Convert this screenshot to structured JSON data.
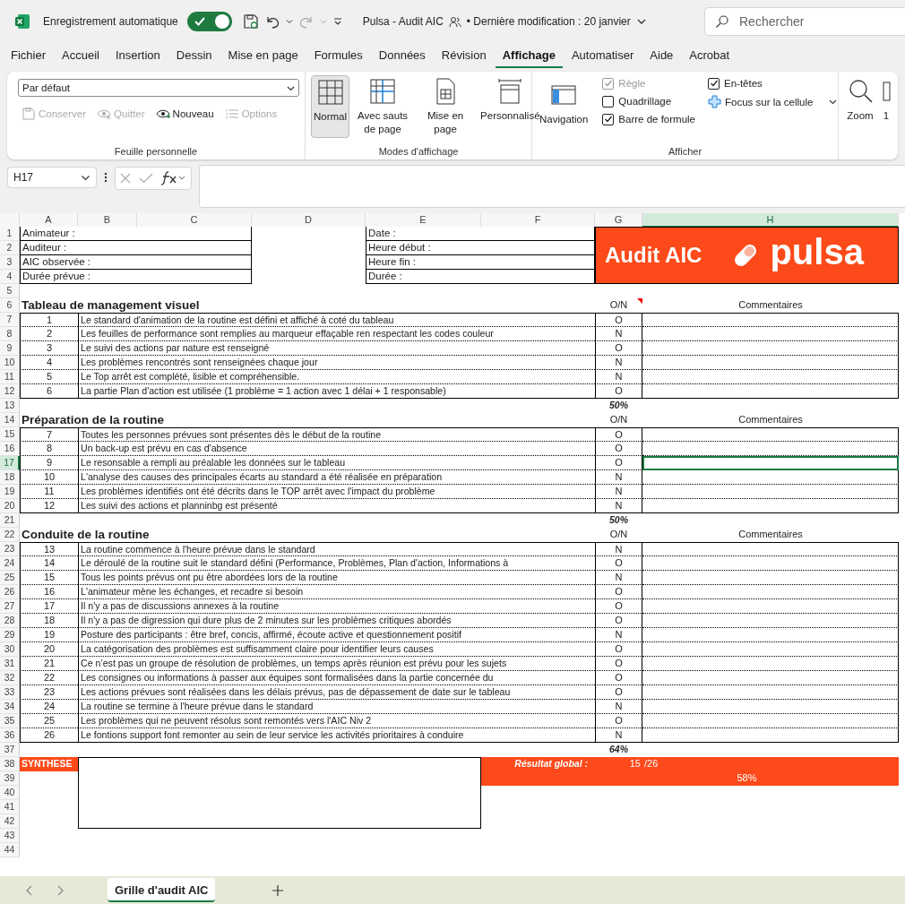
{
  "titlebar": {
    "autosave_label": "Enregistrement automatique",
    "autosave_on": true,
    "title": "Pulsa - Audit AIC",
    "modified": "• Dernière modification : 20 janvier",
    "search_placeholder": "Rechercher"
  },
  "menu_tabs": [
    {
      "label": "Fichier",
      "selected": false
    },
    {
      "label": "Accueil",
      "selected": false
    },
    {
      "label": "Insertion",
      "selected": false
    },
    {
      "label": "Dessin",
      "selected": false
    },
    {
      "label": "Mise en page",
      "selected": false
    },
    {
      "label": "Formules",
      "selected": false
    },
    {
      "label": "Données",
      "selected": false
    },
    {
      "label": "Révision",
      "selected": false
    },
    {
      "label": "Affichage",
      "selected": true
    },
    {
      "label": "Automatiser",
      "selected": false
    },
    {
      "label": "Aide",
      "selected": false
    },
    {
      "label": "Acrobat",
      "selected": false
    }
  ],
  "ribbon": {
    "sheet_view": {
      "dropdown": "Par défaut",
      "group_label": "Feuille personnelle",
      "buttons": [
        {
          "label": "Conserver",
          "disabled": true
        },
        {
          "label": "Quitter",
          "disabled": true
        },
        {
          "label": "Nouveau",
          "disabled": false
        },
        {
          "label": "Options",
          "disabled": true
        }
      ]
    },
    "views": {
      "group_label": "Modes d'affichage",
      "buttons": [
        {
          "label": "Normal",
          "selected": true
        },
        {
          "label": "Avec sauts de page",
          "selected": false
        },
        {
          "label": "Mise en page",
          "selected": false
        },
        {
          "label": "Personnalisé",
          "selected": false
        }
      ]
    },
    "show": {
      "navigation": "Navigation",
      "focus": "Focus sur la cellule",
      "group_label": "Afficher",
      "checkboxes": [
        {
          "label": "Règle",
          "checked": true,
          "disabled": true
        },
        {
          "label": "Quadrillage",
          "checked": false,
          "disabled": false
        },
        {
          "label": "Barre de formule",
          "checked": true,
          "disabled": false
        },
        {
          "label": "En-têtes",
          "checked": true,
          "disabled": false
        }
      ]
    },
    "zoom": {
      "label": "Zoom",
      "cut_label": "1"
    }
  },
  "formula_bar": {
    "name_box": "H17"
  },
  "sheet": {
    "column_headers": [
      {
        "label": "A",
        "selected": false
      },
      {
        "label": "B",
        "selected": false
      },
      {
        "label": "C",
        "selected": false
      },
      {
        "label": "D",
        "selected": false
      },
      {
        "label": "E",
        "selected": false
      },
      {
        "label": "F",
        "selected": false
      },
      {
        "label": "G",
        "selected": false
      },
      {
        "label": "H",
        "selected": true
      }
    ],
    "row_numbers": [
      "1",
      "2",
      "3",
      "4",
      "5",
      "6",
      "7",
      "8",
      "9",
      "10",
      "11",
      "12",
      "13",
      "14",
      "15",
      "16",
      "17",
      "18",
      "19",
      "20",
      "21",
      "22",
      "23",
      "24",
      "25",
      "26",
      "27",
      "28",
      "29",
      "30",
      "31",
      "32",
      "33",
      "34",
      "35",
      "36",
      "37",
      "38",
      "39",
      "40",
      "41",
      "42",
      "43",
      "44"
    ],
    "info_left": [
      "Animateur :",
      "Auditeur :",
      "AIC observée :",
      "Durée prévue :"
    ],
    "info_right": [
      "Date :",
      "Heure début :",
      "Heure fin :",
      "Durée :"
    ],
    "logo": {
      "title": "Audit AIC",
      "brand": "pulsa"
    },
    "sections": [
      {
        "title": "Tableau de management visuel",
        "answer_header": "O/N",
        "comment_header": "Commentaires",
        "comment_marker": true,
        "score": "50%",
        "items": [
          {
            "number": "1",
            "text": "Le standard d'animation de la routine est défini et affiché à coté du tableau",
            "answer": "O",
            "selected": false
          },
          {
            "number": "2",
            "text": "Les feuilles de performance sont remplies au marqueur effaçable ren respectant les codes couleur",
            "answer": "N",
            "selected": false
          },
          {
            "number": "3",
            "text": "Le suivi des actions par nature est renseigné",
            "answer": "O",
            "selected": false
          },
          {
            "number": "4",
            "text": "Les problèmes rencontrés sont renseignées chaque jour",
            "answer": "N",
            "selected": false
          },
          {
            "number": "5",
            "text": "Le Top arrêt est complété, lisible et compréhensible.",
            "answer": "N",
            "selected": false
          },
          {
            "number": "6",
            "text": "La partie Plan d'action est utilisée (1 problème = 1 action avec 1 délai + 1 responsable)",
            "answer": "O",
            "selected": false
          }
        ]
      },
      {
        "title": "Préparation de la routine",
        "answer_header": "O/N",
        "comment_header": "Commentaires",
        "comment_marker": false,
        "score": "50%",
        "items": [
          {
            "number": "7",
            "text": "Toutes les personnes prévues sont présentes dès le début de la routine",
            "answer": "O",
            "selected": false
          },
          {
            "number": "8",
            "text": "Un back-up est prévu en cas d'absence",
            "answer": "O",
            "selected": false
          },
          {
            "number": "9",
            "text": "Le resonsable a rempli au préalable les données sur le tableau",
            "answer": "O",
            "selected": true
          },
          {
            "number": "10",
            "text": "L'analyse des causes des principales écarts au standard a été réalisée en préparation",
            "answer": "N",
            "selected": false
          },
          {
            "number": "11",
            "text": "Les problèmes identifiés ont été décrits dans le TOP arrêt avec l'impact du problème",
            "answer": "N",
            "selected": false
          },
          {
            "number": "12",
            "text": "Les suivi des actions et planninbg est présenté",
            "answer": "N",
            "selected": false
          }
        ]
      },
      {
        "title": "Conduite de la routine",
        "answer_header": "O/N",
        "comment_header": "Commentaires",
        "comment_marker": false,
        "score": "64%",
        "items": [
          {
            "number": "13",
            "text": "La routine commence à l'heure prévue dans le standard",
            "answer": "N",
            "selected": false
          },
          {
            "number": "14",
            "text": "Le déroulé de la routine suit le standard défini (Performance, Problèmes, Plan d'action, Informations à",
            "answer": "O",
            "selected": false
          },
          {
            "number": "15",
            "text": "Tous les points prévus ont pu être abordées lors de la routine",
            "answer": "N",
            "selected": false
          },
          {
            "number": "16",
            "text": "L'animateur mène les échanges, et recadre si besoin",
            "answer": "O",
            "selected": false
          },
          {
            "number": "17",
            "text": "Il n'y a pas de discussions annexes à la routine",
            "answer": "O",
            "selected": false
          },
          {
            "number": "18",
            "text": "Il n'y a pas de digression qui dure plus de 2 minutes sur les problèmes critiques abordés",
            "answer": "O",
            "selected": false
          },
          {
            "number": "19",
            "text": "Posture des participants : être bref, concis, affirmé, écoute active et questionnement positif",
            "answer": "N",
            "selected": false
          },
          {
            "number": "20",
            "text": "La catégorisation des problèmes est suffisamment claire pour identifier leurs causes",
            "answer": "O",
            "selected": false
          },
          {
            "number": "21",
            "text": "Ce n’est pas un groupe de résolution de problèmes, un temps après réunion est prévu pour les sujets",
            "answer": "O",
            "selected": false
          },
          {
            "number": "22",
            "text": "Les consignes ou informations à passer aux équipes sont formalisées dans la partie concernée du",
            "answer": "O",
            "selected": false
          },
          {
            "number": "23",
            "text": "Les actions prévues sont réalisées dans les délais prévus, pas de dépassement de date sur le tableau",
            "answer": "O",
            "selected": false
          },
          {
            "number": "24",
            "text": "La routine se termine à l'heure prévue dans le standard",
            "answer": "N",
            "selected": false
          },
          {
            "number": "25",
            "text": "Les problèmes qui ne peuvent résolus sont remontés vers l'AIC Niv 2",
            "answer": "O",
            "selected": false
          },
          {
            "number": "26",
            "text": "Le fontions support font remonter au sein de leur service les activités prioritaires à conduire",
            "answer": "N",
            "selected": false
          }
        ]
      }
    ],
    "synthesis": {
      "label": "SYNTHESE",
      "result_label": "Résultat global :",
      "score": "15",
      "total": "/26",
      "percent": "58%"
    }
  },
  "sheet_tabs": [
    {
      "label": "Grille d'audit AIC",
      "selected": true
    }
  ]
}
